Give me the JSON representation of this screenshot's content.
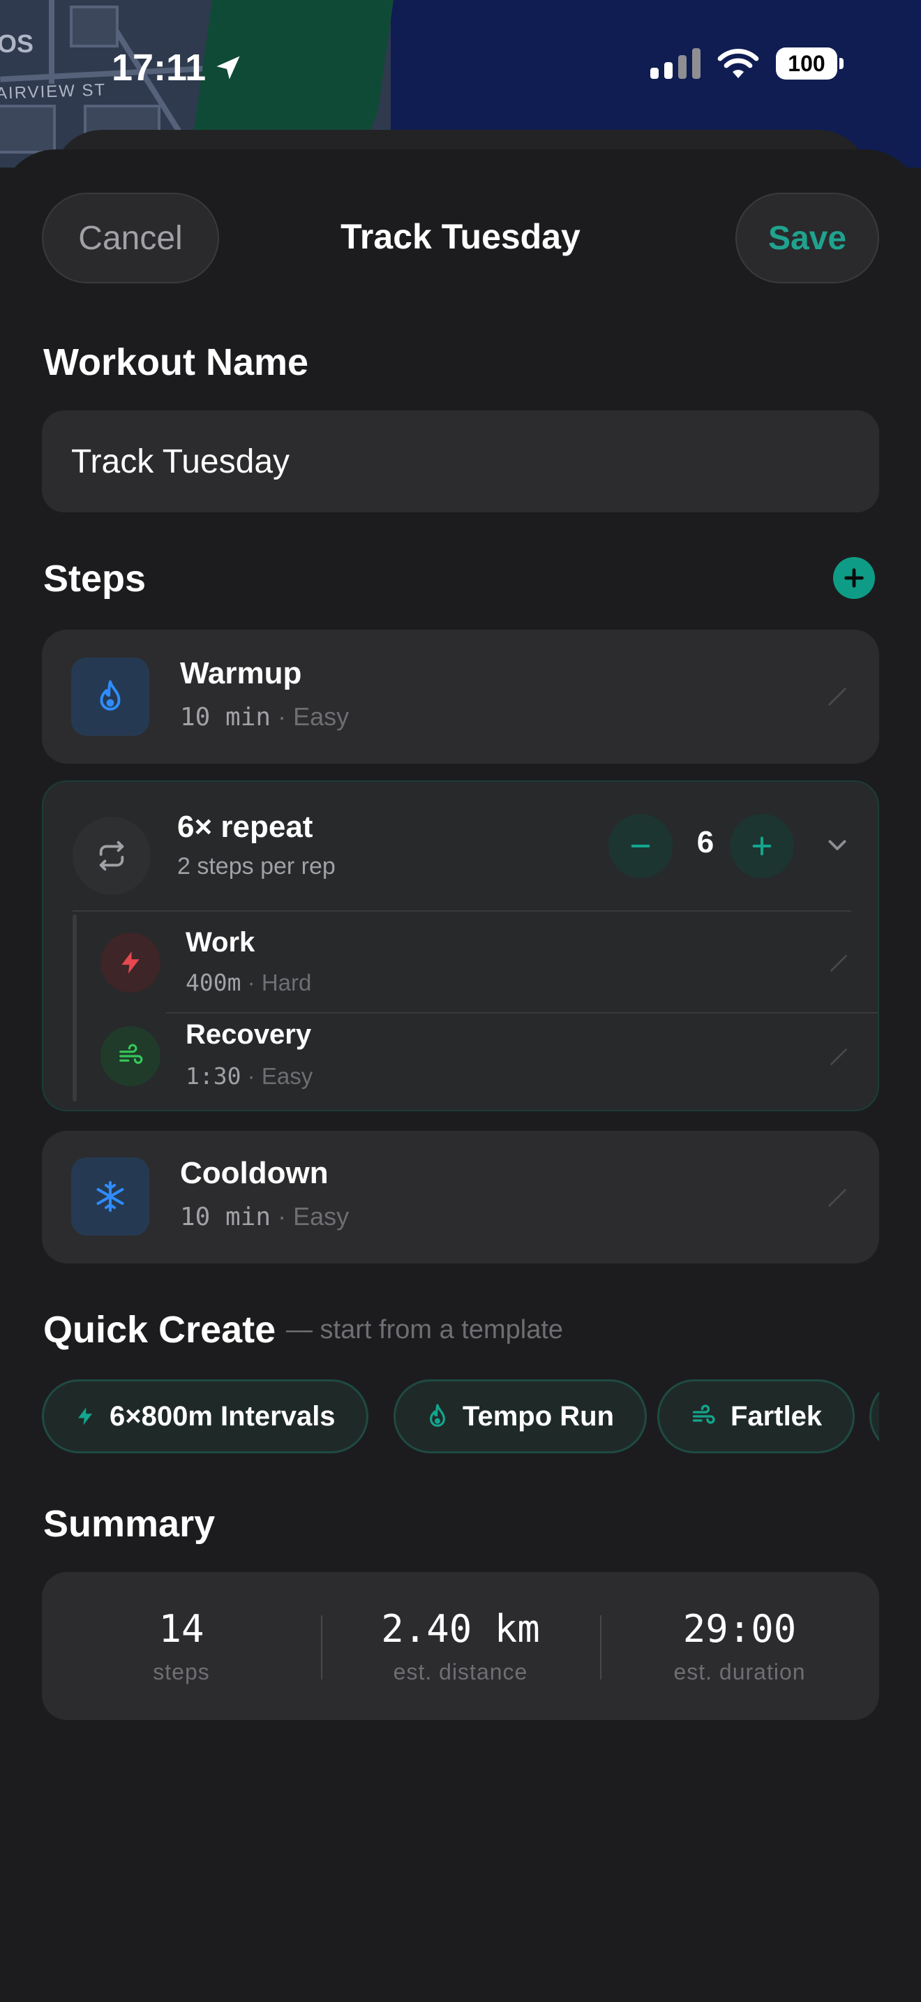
{
  "status": {
    "time": "17:11",
    "battery": "100"
  },
  "map": {
    "street": "AIRVIEW ST",
    "label_top": "OS"
  },
  "nav": {
    "cancel": "Cancel",
    "title": "Track Tuesday",
    "save": "Save"
  },
  "workout_name": {
    "label": "Workout Name",
    "value": "Track Tuesday"
  },
  "steps": {
    "label": "Steps",
    "warmup": {
      "title": "Warmup",
      "value": "10 min",
      "sep": "·",
      "level": "Easy",
      "icon": "flame-icon"
    },
    "repeat": {
      "title": "6× repeat",
      "subtitle": "2 steps per rep",
      "count": "6",
      "work": {
        "title": "Work",
        "value": "400m",
        "sep": "·",
        "level": "Hard",
        "icon": "bolt-icon"
      },
      "recovery": {
        "title": "Recovery",
        "value": "1:30",
        "sep": "·",
        "level": "Easy",
        "icon": "wind-icon"
      }
    },
    "cooldown": {
      "title": "Cooldown",
      "value": "10 min",
      "sep": "·",
      "level": "Easy",
      "icon": "snowflake-icon"
    }
  },
  "quick_create": {
    "label": "Quick Create",
    "hint": "— start from a template",
    "templates": [
      "6×800m Intervals",
      "Tempo Run",
      "Fartlek"
    ]
  },
  "summary": {
    "label": "Summary",
    "steps": {
      "value": "14",
      "label": "steps"
    },
    "distance": {
      "value": "2.40 km",
      "label": "est. distance"
    },
    "duration": {
      "value": "29:00",
      "label": "est. duration"
    }
  },
  "colors": {
    "accent": "#1fa38f",
    "hard": "#e5484d",
    "easy_green": "#34c759",
    "blue": "#2f8cff"
  }
}
